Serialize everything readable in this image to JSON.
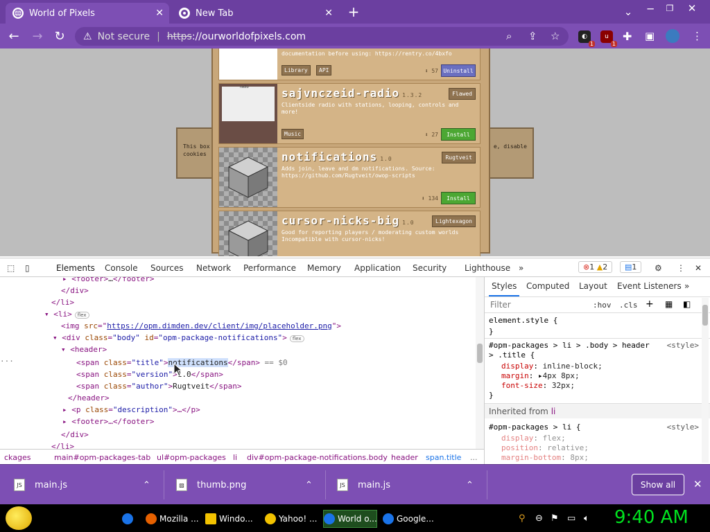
{
  "browser": {
    "tabs": [
      {
        "title": "World of Pixels",
        "active": true
      },
      {
        "title": "New Tab",
        "active": false
      }
    ],
    "new_tab_symbol": "+",
    "security_label": "Not secure",
    "url_scheme": "https",
    "url_rest": "://ourworldofpixels.com",
    "extension_badges": [
      "1",
      "1"
    ]
  },
  "page": {
    "dialog_left_text": "This box\ncookies",
    "dialog_right_text": "e, disable",
    "packages": [
      {
        "desc": "documentation before using: https://rentry.co/4bxfo",
        "tags": [
          "Library",
          "API"
        ],
        "downloads": "57",
        "button": "Uninstall"
      },
      {
        "thumb_caption": "radio",
        "title": "sajvnczeid-radio",
        "version": "1.3.2",
        "author": "Flawed",
        "desc": "Clientside radio with stations, looping, controls and more!",
        "tags": [
          "Music"
        ],
        "downloads": "27",
        "button": "Install"
      },
      {
        "title": "notifications",
        "version": "1.0",
        "author": "Rugtveit",
        "desc": "Adds join, leave and dm notifications. Source: https://github.com/Rugtveit/owop-scripts",
        "tags": [],
        "downloads": "134",
        "button": "Install"
      },
      {
        "title": "cursor-nicks-big",
        "version": "1.0",
        "author": "Lightexagon",
        "desc": "Good for reporting players / moderating custom worlds Incompatible with cursor-nicks!",
        "tags": [],
        "downloads": "",
        "button": ""
      }
    ]
  },
  "devtools": {
    "tabs": [
      "Elements",
      "Console",
      "Sources",
      "Network",
      "Performance",
      "Memory",
      "Application",
      "Security",
      "Lighthouse"
    ],
    "more_tabs": "»",
    "error_count": "1",
    "warning_count": "2",
    "message_count": "1",
    "dom_lines": {
      "l1_tag": "<footer>",
      "l1_ell": "…",
      "l1_end": "</footer>",
      "l2": "</div>",
      "l3": "</li>",
      "l4": "<li>",
      "flex": "flex",
      "l5_open": "<img ",
      "l5_attr": "src",
      "l5_val": "https://opm.dimden.dev/client/img/placeholder.png",
      "l5_close": ">",
      "l6_open": "<div ",
      "l6_attr1": "class",
      "l6_val1": "\"body\"",
      "l6_attr2": "id",
      "l6_val2": "\"opm-package-notifications\"",
      "l6_close": ">",
      "l7": "<header>",
      "l8_open": "<span ",
      "l8_attr": "class",
      "l8_val": "\"title\"",
      "l8_close": ">",
      "l8_text": "notifications",
      "l8_end": "</span>",
      "l8_ref": " == $0",
      "l9_open": "<span ",
      "l9_attr": "class",
      "l9_val": "\"version\"",
      "l9_text": "1.0",
      "l9_end": "</span>",
      "l10_open": "<span ",
      "l10_attr": "class",
      "l10_val": "\"author\"",
      "l10_text": "Rugtveit",
      "l10_end": "</span>",
      "l11": "</header>",
      "l12_open": "<p ",
      "l12_attr": "class",
      "l12_val": "\"description\"",
      "l12_rest": ">…</p>",
      "l13": "<footer>…</footer>",
      "l14": "</div>",
      "l15": "</li>"
    },
    "breadcrumbs": [
      "ckages",
      "main#opm-packages-tab",
      "ul#opm-packages",
      "li",
      "div#opm-package-notifications.body",
      "header",
      "span.title",
      "..."
    ],
    "styles_tabs": [
      "Styles",
      "Computed",
      "Layout",
      "Event Listeners"
    ],
    "filter_placeholder": "Filter",
    "hov": ":hov",
    "cls": ".cls",
    "element_style": "element.style {",
    "close_brace": "}",
    "rule1_selector": "#opm-packages > li > .body > header",
    "rule1_selector2": "> .title {",
    "rule1_source": "<style>",
    "rule1_props": [
      {
        "name": "display",
        "value": "inline-block;"
      },
      {
        "name": "margin",
        "value": "4px 8px;"
      },
      {
        "name": "font-size",
        "value": "32px;"
      }
    ],
    "inherited_label": "Inherited from",
    "inherited_tag": "li",
    "rule2_selector": "#opm-packages > li {",
    "rule2_source": "<style>",
    "rule2_props": [
      {
        "name": "display",
        "value": "flex;"
      },
      {
        "name": "position",
        "value": "relative;"
      },
      {
        "name": "margin-bottom",
        "value": "8px;"
      }
    ]
  },
  "downloads": {
    "items": [
      {
        "name": "main.js"
      },
      {
        "name": "thumb.png"
      },
      {
        "name": "main.js"
      }
    ],
    "show_all": "Show all"
  },
  "taskbar": {
    "items": [
      {
        "label": "",
        "color": "#1a73e8"
      },
      {
        "label": "Mozilla ...",
        "color": "#e66000"
      },
      {
        "label": "Windo...",
        "color": "#f2c200"
      },
      {
        "label": "Yahoo! ...",
        "color": "#f2c200"
      },
      {
        "label": "World o...",
        "color": "#1a73e8"
      },
      {
        "label": "Google...",
        "color": "#1a73e8"
      }
    ],
    "clock": "9:40 AM"
  },
  "colors": {
    "brand_purple": "#7d4fb4",
    "clock_green": "#00e21f",
    "install_green": "#4ca733"
  }
}
